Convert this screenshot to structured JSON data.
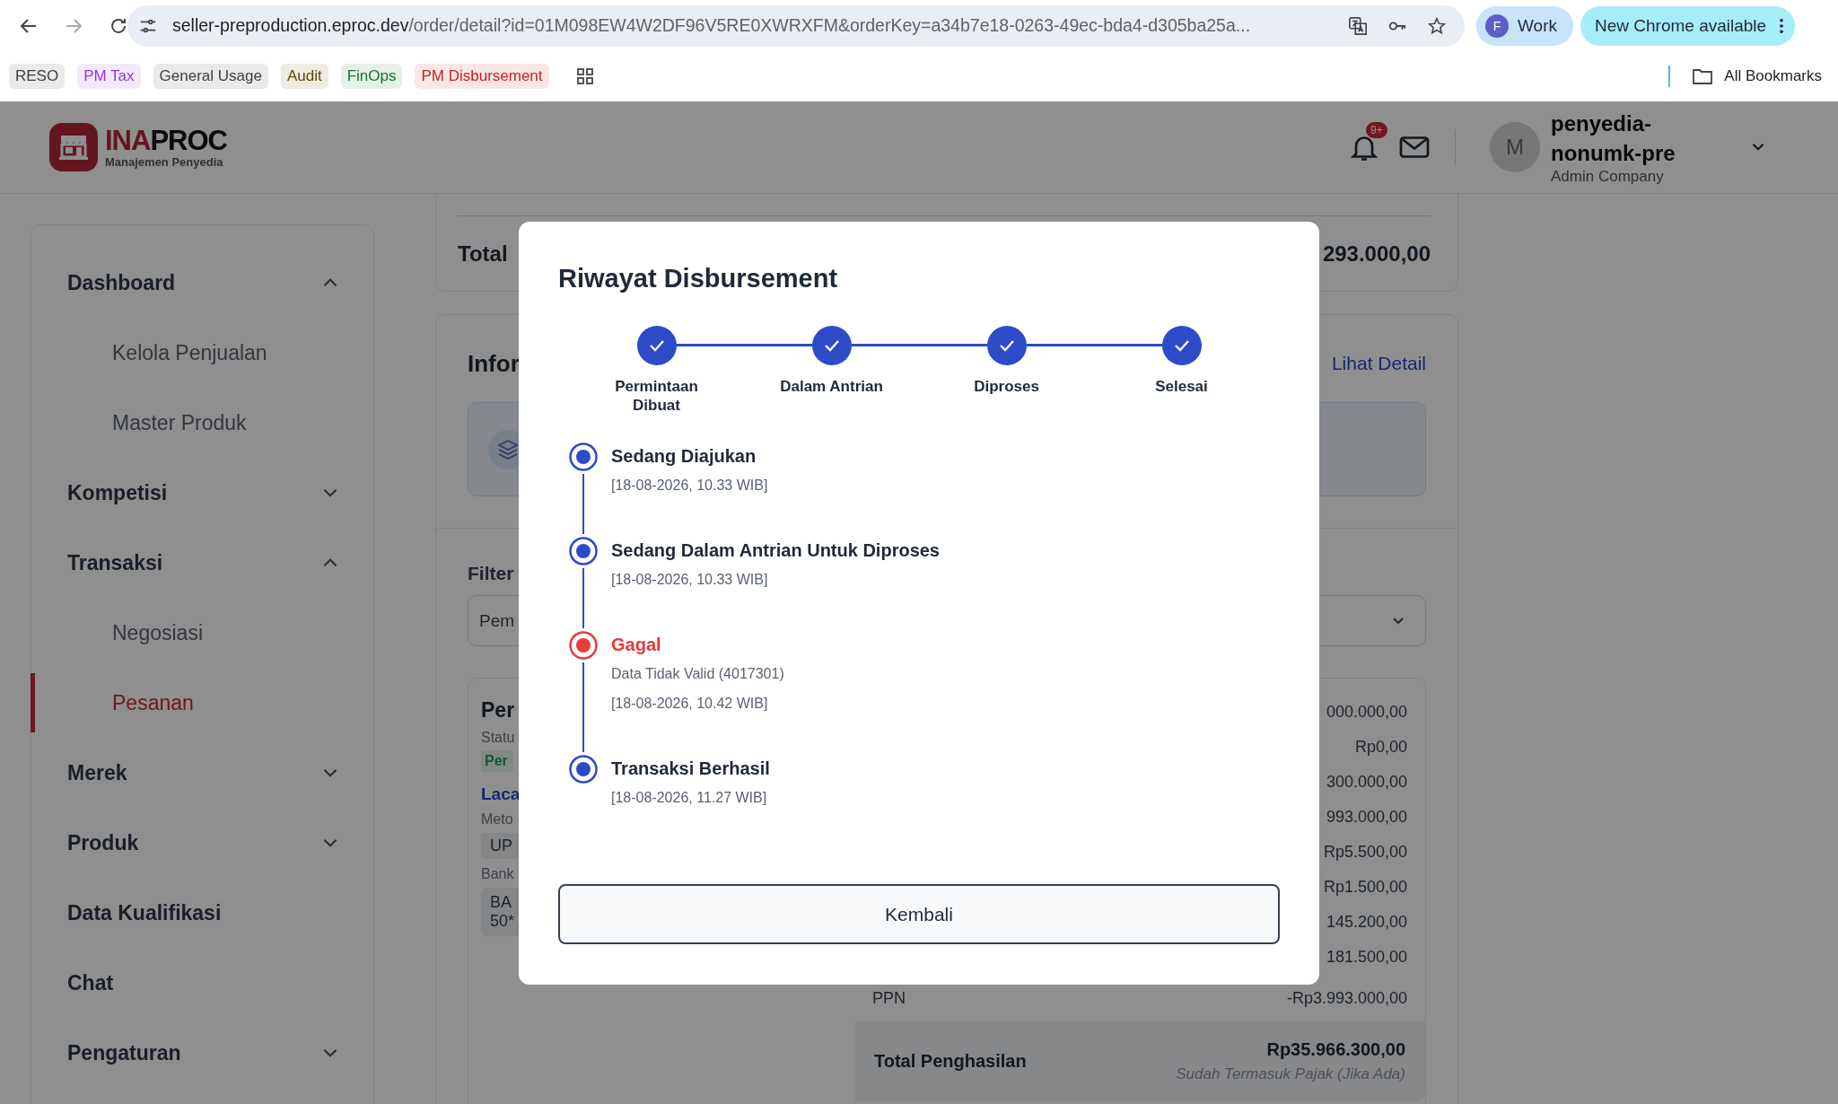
{
  "browser": {
    "url_host": "seller-preproduction.eproc.dev",
    "url_path": "/order/detail?id=01M098EW4W2DF96V5RE0XWRXFM&orderKey=a34b7e18-0263-49ec-bda4-d305ba25a...",
    "profile": {
      "initial": "F",
      "name": "Work"
    },
    "update_button": "New Chrome available",
    "bookmarks": [
      {
        "label": "RESO",
        "color": "#3c4043"
      },
      {
        "label": "PM Tax",
        "color": "#9334e6"
      },
      {
        "label": "General Usage",
        "color": "#3c4043"
      },
      {
        "label": "Audit",
        "color": "#5f4b00"
      },
      {
        "label": "FinOps",
        "color": "#137333"
      },
      {
        "label": "PM Disbursement",
        "color": "#c5221f"
      }
    ],
    "all_bookmarks": "All Bookmarks"
  },
  "header": {
    "logo": {
      "name_accent": "INA",
      "name_rest": "PROC",
      "subtitle": "Manajemen Penyedia"
    },
    "notification_badge": "9+",
    "user": {
      "initial": "M",
      "name": "penyedia-nonumk-pre",
      "role": "Admin Company"
    }
  },
  "sidebar": {
    "items": [
      {
        "label": "Dashboard",
        "kind": "group",
        "expanded": true,
        "selected": false,
        "children": [
          {
            "label": "Kelola Penjualan",
            "selected": false
          },
          {
            "label": "Master Produk",
            "selected": false
          }
        ]
      },
      {
        "label": "Kompetisi",
        "kind": "group",
        "expanded": false,
        "selected": false
      },
      {
        "label": "Transaksi",
        "kind": "group",
        "expanded": true,
        "selected": false,
        "children": [
          {
            "label": "Negosiasi",
            "selected": false
          },
          {
            "label": "Pesanan",
            "selected": true
          }
        ]
      },
      {
        "label": "Merek",
        "kind": "group",
        "expanded": false,
        "selected": false
      },
      {
        "label": "Produk",
        "kind": "group",
        "expanded": false,
        "selected": false
      },
      {
        "label": "Data Kualifikasi",
        "kind": "link",
        "selected": false
      },
      {
        "label": "Chat",
        "kind": "link",
        "selected": false
      },
      {
        "label": "Pengaturan",
        "kind": "group",
        "expanded": false,
        "selected": false
      }
    ]
  },
  "main": {
    "summary": {
      "label": "Total",
      "amount": "293.000,00"
    },
    "info": {
      "title": "Infor",
      "link": "Lihat Detail"
    },
    "filter": {
      "label": "Filter",
      "value": "Pem"
    },
    "order": {
      "title": "Per",
      "status_label": "Statu",
      "status": "Per",
      "link": "Laca",
      "method_label": "Meto",
      "method": "UP",
      "bank_label": "Bank",
      "bank_lines": [
        "BA",
        "50*"
      ]
    },
    "price_rows": [
      "000.000,00",
      "Rp0,00",
      "300.000,00",
      "993.000,00",
      "Rp5.500,00",
      "Rp1.500,00",
      "145.200,00",
      "181.500,00"
    ],
    "ppn": {
      "label": "PPN",
      "amount": "-Rp3.993.000,00"
    },
    "total": {
      "label": "Total Penghasilan",
      "amount": "Rp35.966.300,00",
      "note": "Sudah Termasuk Pajak (Jika Ada)"
    }
  },
  "modal": {
    "title": "Riwayat Disbursement",
    "steps": [
      {
        "label": "Permintaan Dibuat",
        "done": true
      },
      {
        "label": "Dalam Antrian",
        "done": true
      },
      {
        "label": "Diproses",
        "done": true
      },
      {
        "label": "Selesai",
        "done": true
      }
    ],
    "history": [
      {
        "title": "Sedang Diajukan",
        "failed": false,
        "time": "[18-08-2026, 10.33 WIB]"
      },
      {
        "title": "Sedang Dalam Antrian Untuk Diproses",
        "failed": false,
        "time": "[18-08-2026, 10.33 WIB]"
      },
      {
        "title": "Gagal",
        "failed": true,
        "note": "Data Tidak Valid (4017301)",
        "time": "[18-08-2026, 10.42 WIB]"
      },
      {
        "title": "Transaksi Berhasil",
        "failed": false,
        "time": "[18-08-2026, 11.27 WIB]"
      }
    ],
    "button": "Kembali"
  }
}
